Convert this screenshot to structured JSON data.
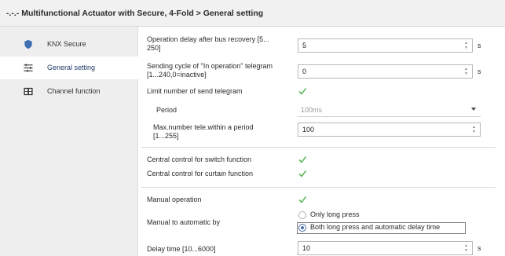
{
  "window": {
    "title": "-.-.- Multifunctional Actuator with Secure, 4-Fold > General setting"
  },
  "sidebar": {
    "items": [
      {
        "label": "KNX Secure",
        "icon": "shield-icon",
        "active": false
      },
      {
        "label": "General setting",
        "icon": "sliders-icon",
        "active": true
      },
      {
        "label": "Channel function",
        "icon": "grid-icon",
        "active": false
      }
    ]
  },
  "params": {
    "op_delay": {
      "label_line1": "Operation delay after bus recovery [5...",
      "label_line2": "250]",
      "value": "5",
      "unit": "s"
    },
    "sending_cycle": {
      "label_line1": "Sending cycle of \"In operation\" telegram",
      "label_line2": "[1...240,0=inactive]",
      "value": "0",
      "unit": "s"
    },
    "limit_send": {
      "label": "Limit number of send telegram",
      "checked": true
    },
    "period": {
      "label": "Period",
      "value": "100ms"
    },
    "max_number": {
      "label_line1": "Max.number tele.within a period",
      "label_line2": "[1...255]",
      "value": "100"
    },
    "central_switch": {
      "label": "Central control for switch function",
      "checked": true
    },
    "central_curtain": {
      "label": "Central control for curtain function",
      "checked": true
    },
    "manual_operation": {
      "label": "Manual operation",
      "checked": true
    },
    "manual_to_auto": {
      "label": "Manual to automatic by",
      "options": [
        "Only long press",
        "Both long press and automatic delay time"
      ],
      "selected_index": 1
    },
    "delay_time": {
      "label": "Delay time [10...6000]",
      "value": "10",
      "unit": "s"
    }
  },
  "colors": {
    "check": "#5fb85f",
    "shield": "#3d6fb3",
    "accent": "#4a6fa8"
  }
}
